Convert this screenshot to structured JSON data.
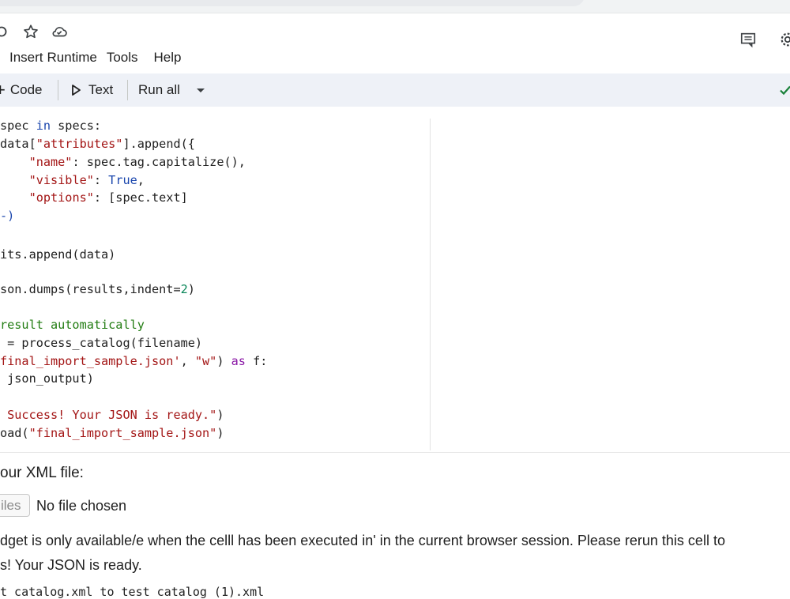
{
  "title_bar": {
    "star_icon": "star-outline",
    "cloud_icon": "cloud-saved",
    "comment_icon": "comment",
    "settings_icon": "gear"
  },
  "menu": {
    "items": [
      "Insert",
      "Runtime",
      "Tools",
      "Help"
    ]
  },
  "toolbar": {
    "code_label": "Code",
    "text_label": "Text",
    "run_all_label": "Run all",
    "status_icon": "check"
  },
  "code": {
    "l1a": "spec ",
    "l1kw": "in",
    "l1b": " specs:",
    "l2a": "data[",
    "l2s": "\"attributes\"",
    "l2b": "].append({",
    "l3pre": "    ",
    "l3s": "\"name\"",
    "l3b": ": spec.tag.capitalize(),",
    "l4pre": "    ",
    "l4s": "\"visible\"",
    "l4b": ": ",
    "l4kw": "True",
    "l4c": ",",
    "l5pre": "    ",
    "l5s": "\"options\"",
    "l5b": ": [spec.text]",
    "l6": "-)",
    "l7": "its.append(data)",
    "l8a": "son.dumps(results,indent=",
    "l8n": "2",
    "l8b": ")",
    "l9": "result automatically",
    "l10": " = process_catalog(filename)",
    "l11s": "final_import_sample.json'",
    "l11b": ", ",
    "l11s2": "\"w\"",
    "l11c": ") ",
    "l11kw": "as",
    "l11d": " f:",
    "l12": " json_output)",
    "l13s": " Success! Your JSON is ready.\"",
    "l13b": ")",
    "l14a": "oad(",
    "l14s": "\"final_import_sample.json\"",
    "l14b": ")"
  },
  "output": {
    "prompt": "our XML file:",
    "choose_files": "iles",
    "no_file": "No file chosen",
    "widget_msg": "dget is only available/e when the celll has been executed in' in the current browser session. Please rerun this cell to",
    "success": "s! Your JSON is ready.",
    "saved": "t catalog.xml to test catalog (1).xml"
  },
  "colors": {
    "toolbar_bg": "#eef1f7",
    "keyword": "#1a46ad",
    "string": "#a31515",
    "comment": "#237d13",
    "status_check": "#188038"
  }
}
